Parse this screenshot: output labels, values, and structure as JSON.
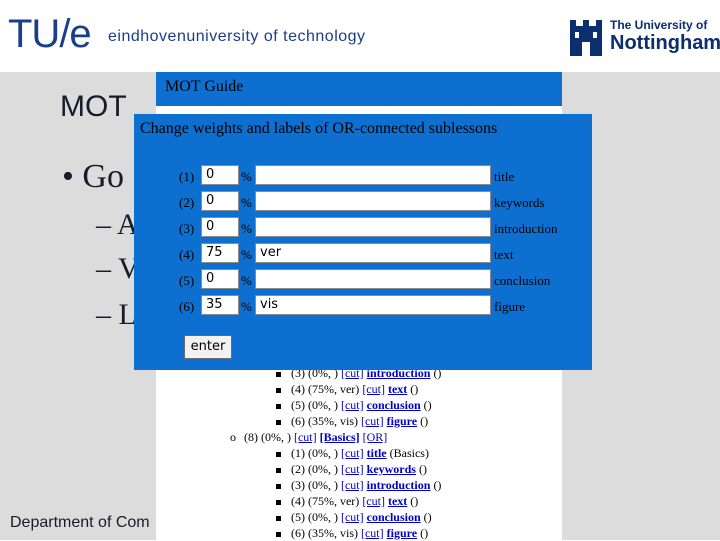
{
  "header": {
    "tue_logo": "TU/e",
    "tue_tagline": "eindhovenuniversity of technology",
    "nottingham_small": "The University of",
    "nottingham_big": "Nottingham"
  },
  "slide": {
    "title": "MOT",
    "bullets": [
      "• Go",
      "– A",
      "– V",
      "– L"
    ],
    "footer": "Department of Com"
  },
  "guide": {
    "title": "MOT Guide",
    "tree": [
      {
        "marker": "square",
        "pre": "(3) (0%, ) ",
        "cut": "[cut]",
        "link": "introduction",
        "post": " ()"
      },
      {
        "marker": "square",
        "pre": "(4) (75%, ver) ",
        "cut": "[cut]",
        "link": "text",
        "post": " ()"
      },
      {
        "marker": "square",
        "pre": "(5) (0%, ) ",
        "cut": "[cut]",
        "link": "conclusion",
        "post": " ()"
      },
      {
        "marker": "square",
        "pre": "(6) (35%, vis) ",
        "cut": "[cut]",
        "link": "figure",
        "post": " ()"
      },
      {
        "marker": "circle",
        "pre": "(8) (0%, ) ",
        "cut": "[cut]",
        "link": "[Basics]",
        "post": " ",
        "or": "[OR]"
      },
      {
        "marker": "square",
        "pre": "(1) (0%, ) ",
        "cut": "[cut]",
        "link": "title",
        "post": " (Basics)"
      },
      {
        "marker": "square",
        "pre": "(2) (0%, ) ",
        "cut": "[cut]",
        "link": "keywords",
        "post": " ()"
      },
      {
        "marker": "square",
        "pre": "(3) (0%, ) ",
        "cut": "[cut]",
        "link": "introduction",
        "post": " ()"
      },
      {
        "marker": "square",
        "pre": "(4) (75%, ver) ",
        "cut": "[cut]",
        "link": "text",
        "post": " ()"
      },
      {
        "marker": "square",
        "pre": "(5) (0%, ) ",
        "cut": "[cut]",
        "link": "conclusion",
        "post": " ()"
      },
      {
        "marker": "square",
        "pre": "(6) (35%, vis) ",
        "cut": "[cut]",
        "link": "figure",
        "post": " ()"
      }
    ]
  },
  "modal": {
    "title": "Change weights and labels of OR-connected sublessons",
    "percent_sign": "%",
    "rows": [
      {
        "num": "(1)",
        "weight": "0",
        "label": "",
        "name": "title"
      },
      {
        "num": "(2)",
        "weight": "0",
        "label": "",
        "name": "keywords"
      },
      {
        "num": "(3)",
        "weight": "0",
        "label": "",
        "name": "introduction"
      },
      {
        "num": "(4)",
        "weight": "75",
        "label": "ver",
        "name": "text"
      },
      {
        "num": "(5)",
        "weight": "0",
        "label": "",
        "name": "conclusion"
      },
      {
        "num": "(6)",
        "weight": "35",
        "label": "vis",
        "name": "figure"
      }
    ],
    "enter_label": "enter"
  },
  "colors": {
    "modal_blue": "#0d6fd0",
    "link_blue": "#0000cc",
    "tue_blue": "#1a3e8c"
  }
}
